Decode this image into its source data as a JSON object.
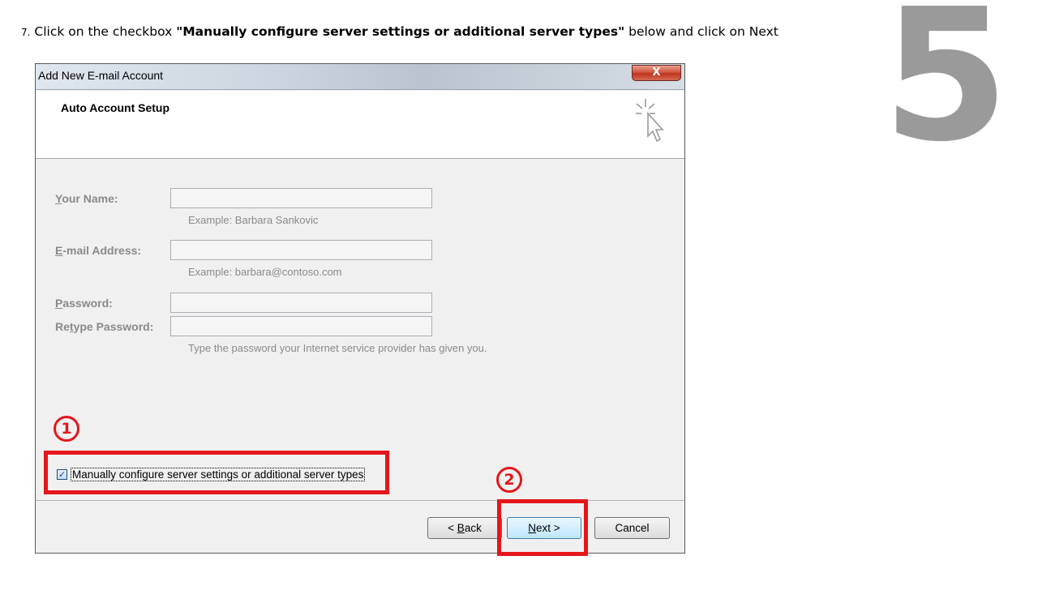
{
  "instruction": {
    "number": "7.",
    "prefix": "Click on the checkbox ",
    "bold": "\"Manually configure server settings or additional server types\"",
    "suffix": " below and click on Next"
  },
  "step_number": "5",
  "dialog": {
    "title": "Add New E-mail Account",
    "close_label": "X",
    "header_title": "Auto Account Setup",
    "fields": {
      "your_name": {
        "label_key": "Y",
        "label_rest": "our Name:",
        "value": "",
        "hint": "Example: Barbara Sankovic"
      },
      "email": {
        "label_key": "E",
        "label_rest": "-mail Address:",
        "value": "",
        "hint": "Example: barbara@contoso.com"
      },
      "password": {
        "label_key": "P",
        "label_rest": "assword:",
        "value": ""
      },
      "retype": {
        "label_pre": "Re",
        "label_key": "t",
        "label_rest": "ype Password:",
        "value": "",
        "hint": "Type the password your Internet service provider has given you."
      }
    },
    "manual_config": {
      "checked": true,
      "check_glyph": "✓",
      "label": "Manually configure server settings or additional server types"
    },
    "buttons": {
      "back": {
        "pre": "< ",
        "key": "B",
        "rest": "ack"
      },
      "next": {
        "key": "N",
        "rest": "ext >"
      },
      "cancel": "Cancel"
    }
  },
  "annotations": {
    "marker_1": "1",
    "marker_2": "2",
    "highlight_color": "#e4161b"
  },
  "colors": {
    "step_number": "#9a9a9a",
    "disabled_text": "#8a8a8a"
  }
}
